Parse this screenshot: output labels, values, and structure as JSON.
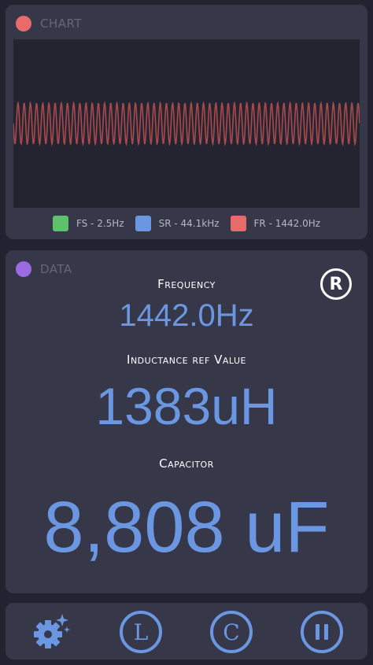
{
  "chart_panel": {
    "title": "CHART",
    "dot_color": "#e96a6a",
    "wave_color": "#a9494c",
    "legend": [
      {
        "label": "FS - 2.5Hz",
        "color": "#5ec26b"
      },
      {
        "label": "SR - 44.1kHz",
        "color": "#6b97e2"
      },
      {
        "label": "FR - 1442.0Hz",
        "color": "#e96a6a"
      }
    ]
  },
  "data_panel": {
    "title": "DATA",
    "dot_color": "#9b6be2",
    "registered_mark": "R",
    "frequency_label": "Frequency",
    "frequency_value": "1442.0Hz",
    "inductance_label": "Inductance ref Value",
    "inductance_value": "1383uH",
    "capacitor_label": "Capacitor",
    "capacitor_value": "8,808 uF"
  },
  "toolbar": {
    "settings_icon": "gear-sparkle-icon",
    "l_label": "L",
    "c_label": "C",
    "pause_icon": "pause-icon",
    "accent": "#6b97e2"
  }
}
